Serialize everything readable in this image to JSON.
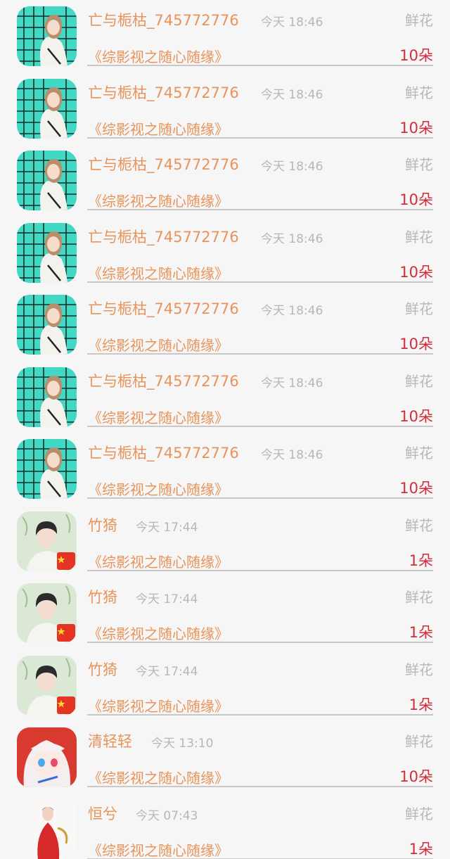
{
  "rows": [
    {
      "avatar": "girl-portrait-avatar",
      "name": "亡与栀枯_745772776",
      "time": "今天 18:46",
      "type": "鲜花",
      "book": "《综影视之随心随缘》",
      "count": "10朵"
    },
    {
      "avatar": "girl-portrait-avatar",
      "name": "亡与栀枯_745772776",
      "time": "今天 18:46",
      "type": "鲜花",
      "book": "《综影视之随心随缘》",
      "count": "10朵"
    },
    {
      "avatar": "girl-portrait-avatar",
      "name": "亡与栀枯_745772776",
      "time": "今天 18:46",
      "type": "鲜花",
      "book": "《综影视之随心随缘》",
      "count": "10朵"
    },
    {
      "avatar": "girl-portrait-avatar",
      "name": "亡与栀枯_745772776",
      "time": "今天 18:46",
      "type": "鲜花",
      "book": "《综影视之随心随缘》",
      "count": "10朵"
    },
    {
      "avatar": "girl-portrait-avatar",
      "name": "亡与栀枯_745772776",
      "time": "今天 18:46",
      "type": "鲜花",
      "book": "《综影视之随心随缘》",
      "count": "10朵"
    },
    {
      "avatar": "girl-portrait-avatar",
      "name": "亡与栀枯_745772776",
      "time": "今天 18:46",
      "type": "鲜花",
      "book": "《综影视之随心随缘》",
      "count": "10朵"
    },
    {
      "avatar": "girl-portrait-avatar",
      "name": "亡与栀枯_745772776",
      "time": "今天 18:46",
      "type": "鲜花",
      "book": "《综影视之随心随缘》",
      "count": "10朵"
    },
    {
      "avatar": "man-flag-avatar",
      "name": "竹猗",
      "time": "今天 17:44",
      "type": "鲜花",
      "book": "《综影视之随心随缘》",
      "count": "1朵"
    },
    {
      "avatar": "man-flag-avatar",
      "name": "竹猗",
      "time": "今天 17:44",
      "type": "鲜花",
      "book": "《综影视之随心随缘》",
      "count": "1朵"
    },
    {
      "avatar": "man-flag-avatar",
      "name": "竹猗",
      "time": "今天 17:44",
      "type": "鲜花",
      "book": "《综影视之随心随缘》",
      "count": "1朵"
    },
    {
      "avatar": "anime-girl-avatar",
      "name": "清轻轻",
      "time": "今天 13:10",
      "type": "鲜花",
      "book": "《综影视之随心随缘》",
      "count": "10朵"
    },
    {
      "avatar": "red-dress-avatar",
      "name": "恒兮",
      "time": "今天 07:43",
      "type": "鲜花",
      "book": "《综影视之随心随缘》",
      "count": "1朵"
    }
  ]
}
